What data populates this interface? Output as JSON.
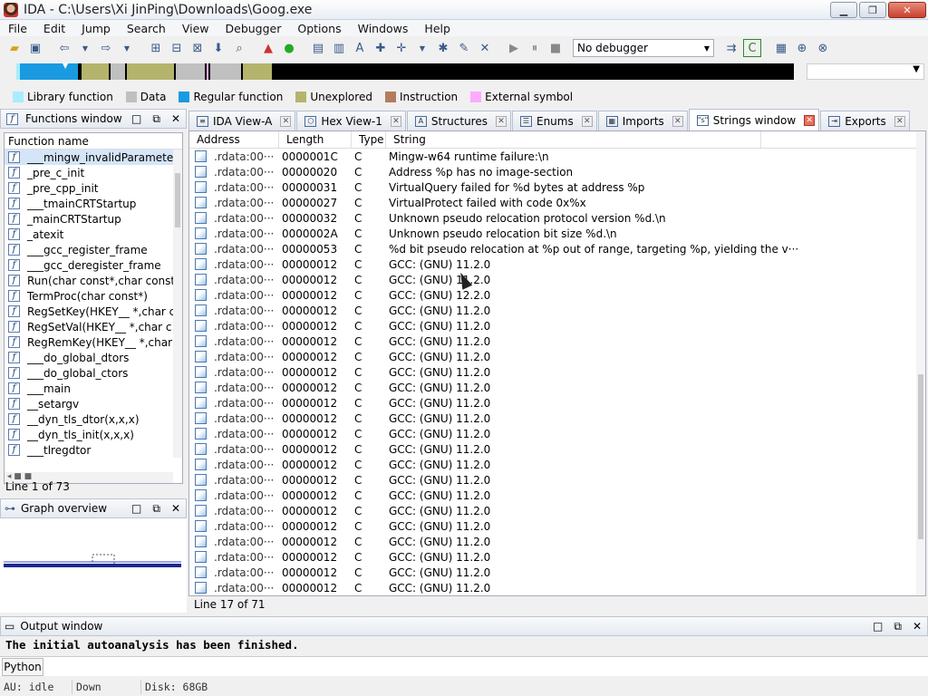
{
  "window": {
    "title": "IDA - C:\\Users\\Xi JinPing\\Downloads\\Goog.exe"
  },
  "menu": [
    "File",
    "Edit",
    "Jump",
    "Search",
    "View",
    "Debugger",
    "Options",
    "Windows",
    "Help"
  ],
  "toolbar": {
    "debugger_select": "No debugger"
  },
  "legend": [
    {
      "label": "Library function",
      "color": "#a8ecff"
    },
    {
      "label": "Data",
      "color": "#c0c0c0"
    },
    {
      "label": "Regular function",
      "color": "#1a9ae0"
    },
    {
      "label": "Unexplored",
      "color": "#b4b46c"
    },
    {
      "label": "Instruction",
      "color": "#b47c5c"
    },
    {
      "label": "External symbol",
      "color": "#ffaaff"
    }
  ],
  "functions_window": {
    "title": "Functions window",
    "column": "Function name",
    "items": [
      "___mingw_invalidParameterHa",
      "_pre_c_init",
      "_pre_cpp_init",
      "___tmainCRTStartup",
      "_mainCRTStartup",
      "_atexit",
      "___gcc_register_frame",
      "___gcc_deregister_frame",
      "Run(char const*,char const*,",
      "TermProc(char const*)",
      "RegSetKey(HKEY__ *,char c",
      "RegSetVal(HKEY__ *,char c",
      "RegRemKey(HKEY__ *,char",
      "___do_global_dtors",
      "___do_global_ctors",
      "___main",
      "__setargv",
      "__dyn_tls_dtor(x,x,x)",
      "__dyn_tls_init(x,x,x)",
      "___tlregdtor"
    ],
    "status": "Line 1 of 73"
  },
  "graph_overview": {
    "title": "Graph overview"
  },
  "tabs": [
    {
      "label": "IDA View-A",
      "icon": "≡"
    },
    {
      "label": "Hex View-1",
      "icon": "⬡"
    },
    {
      "label": "Structures",
      "icon": "A"
    },
    {
      "label": "Enums",
      "icon": "☰"
    },
    {
      "label": "Imports",
      "icon": "▦"
    },
    {
      "label": "Strings window",
      "icon": "\"s\""
    },
    {
      "label": "Exports",
      "icon": "⇥"
    }
  ],
  "strings_window": {
    "columns": [
      "Address",
      "Length",
      "Type",
      "String"
    ],
    "rows": [
      {
        "address": ".rdata:00···",
        "length": "0000001C",
        "type": "C",
        "string": "Mingw-w64 runtime failure:\\n"
      },
      {
        "address": ".rdata:00···",
        "length": "00000020",
        "type": "C",
        "string": "Address %p has no image-section"
      },
      {
        "address": ".rdata:00···",
        "length": "00000031",
        "type": "C",
        "string": "  VirtualQuery failed for %d bytes at address %p"
      },
      {
        "address": ".rdata:00···",
        "length": "00000027",
        "type": "C",
        "string": "  VirtualProtect failed with code 0x%x"
      },
      {
        "address": ".rdata:00···",
        "length": "00000032",
        "type": "C",
        "string": "  Unknown pseudo relocation protocol version %d.\\n"
      },
      {
        "address": ".rdata:00···",
        "length": "0000002A",
        "type": "C",
        "string": "  Unknown pseudo relocation bit size %d.\\n"
      },
      {
        "address": ".rdata:00···",
        "length": "00000053",
        "type": "C",
        "string": "%d bit pseudo relocation at %p out of range, targeting %p, yielding the v···"
      },
      {
        "address": ".rdata:00···",
        "length": "00000012",
        "type": "C",
        "string": "GCC: (GNU) 11.2.0"
      },
      {
        "address": ".rdata:00···",
        "length": "00000012",
        "type": "C",
        "string": "GCC: (GNU) 11.2.0"
      },
      {
        "address": ".rdata:00···",
        "length": "00000012",
        "type": "C",
        "string": "GCC: (GNU) 12.2.0"
      },
      {
        "address": ".rdata:00···",
        "length": "00000012",
        "type": "C",
        "string": "GCC: (GNU) 11.2.0"
      },
      {
        "address": ".rdata:00···",
        "length": "00000012",
        "type": "C",
        "string": "GCC: (GNU) 11.2.0"
      },
      {
        "address": ".rdata:00···",
        "length": "00000012",
        "type": "C",
        "string": "GCC: (GNU) 11.2.0"
      },
      {
        "address": ".rdata:00···",
        "length": "00000012",
        "type": "C",
        "string": "GCC: (GNU) 11.2.0"
      },
      {
        "address": ".rdata:00···",
        "length": "00000012",
        "type": "C",
        "string": "GCC: (GNU) 11.2.0"
      },
      {
        "address": ".rdata:00···",
        "length": "00000012",
        "type": "C",
        "string": "GCC: (GNU) 11.2.0"
      },
      {
        "address": ".rdata:00···",
        "length": "00000012",
        "type": "C",
        "string": "GCC: (GNU) 11.2.0"
      },
      {
        "address": ".rdata:00···",
        "length": "00000012",
        "type": "C",
        "string": "GCC: (GNU) 11.2.0"
      },
      {
        "address": ".rdata:00···",
        "length": "00000012",
        "type": "C",
        "string": "GCC: (GNU) 11.2.0"
      },
      {
        "address": ".rdata:00···",
        "length": "00000012",
        "type": "C",
        "string": "GCC: (GNU) 11.2.0"
      },
      {
        "address": ".rdata:00···",
        "length": "00000012",
        "type": "C",
        "string": "GCC: (GNU) 11.2.0"
      },
      {
        "address": ".rdata:00···",
        "length": "00000012",
        "type": "C",
        "string": "GCC: (GNU) 11.2.0"
      },
      {
        "address": ".rdata:00···",
        "length": "00000012",
        "type": "C",
        "string": "GCC: (GNU) 11.2.0"
      },
      {
        "address": ".rdata:00···",
        "length": "00000012",
        "type": "C",
        "string": "GCC: (GNU) 11.2.0"
      },
      {
        "address": ".rdata:00···",
        "length": "00000012",
        "type": "C",
        "string": "GCC: (GNU) 11.2.0"
      },
      {
        "address": ".rdata:00···",
        "length": "00000012",
        "type": "C",
        "string": "GCC: (GNU) 11.2.0"
      },
      {
        "address": ".rdata:00···",
        "length": "00000012",
        "type": "C",
        "string": "GCC: (GNU) 11.2.0"
      },
      {
        "address": ".rdata:00···",
        "length": "00000012",
        "type": "C",
        "string": "GCC: (GNU) 11.2.0"
      },
      {
        "address": ".rdata:00···",
        "length": "00000012",
        "type": "C",
        "string": "GCC: (GNU) 11.2.0"
      }
    ],
    "status": "Line 17 of 71"
  },
  "output_window": {
    "title": "Output window",
    "text": "The initial autoanalysis has been finished.",
    "python_button": "Python"
  },
  "statusbar": {
    "au": "AU:  idle",
    "dir": "Down",
    "disk": "Disk: 68GB"
  }
}
